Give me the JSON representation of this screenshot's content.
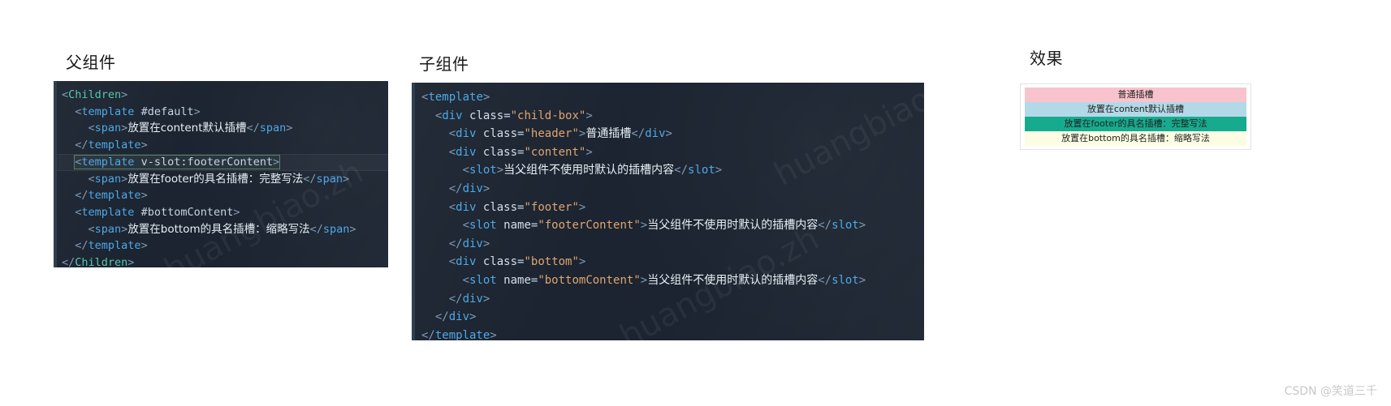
{
  "headings": {
    "parent": "父组件",
    "child": "子组件",
    "effect": "效果"
  },
  "parent_code": {
    "watermark": "huangbiao.zh",
    "lines": [
      {
        "id": "p1",
        "text": "<Children>"
      },
      {
        "id": "p2",
        "text": "  <template #default>"
      },
      {
        "id": "p3",
        "text": "    <span>放置在content默认插槽</span>"
      },
      {
        "id": "p4",
        "text": "  </template>"
      },
      {
        "id": "p5",
        "text": "  <template v-slot:footerContent>"
      },
      {
        "id": "p6",
        "text": "    <span>放置在footer的具名插槽：完整写法</span>"
      },
      {
        "id": "p7",
        "text": "  </template>"
      },
      {
        "id": "p8",
        "text": "  <template #bottomContent>"
      },
      {
        "id": "p9",
        "text": "    <span>放置在bottom的具名插槽：缩略写法</span>"
      },
      {
        "id": "p10",
        "text": "  </template>"
      },
      {
        "id": "p11",
        "text": "</Children>"
      }
    ],
    "tokens": {
      "tag_children_open": "Children",
      "tag_template": "template",
      "attr_default": "#default",
      "attr_vslot_footer": "v-slot:footerContent",
      "attr_bottom": "#bottomContent",
      "tag_span": "span",
      "text_default": "放置在content默认插槽",
      "text_footer": "放置在footer的具名插槽：完整写法",
      "text_bottom": "放置在bottom的具名插槽：缩略写法"
    }
  },
  "child_code": {
    "watermark": "huangbiao.zh",
    "tokens": {
      "tag_template": "template",
      "tag_div": "div",
      "tag_slot": "slot",
      "attr_class": "class",
      "class_child_box": "\"child-box\"",
      "class_header": "\"header\"",
      "class_content": "\"content\"",
      "class_footer": "\"footer\"",
      "class_bottom": "\"bottom\"",
      "attr_name": "name",
      "name_footer": "\"footerContent\"",
      "name_bottom": "\"bottomContent\"",
      "text_header": "普通插槽",
      "text_slot_default": "当父组件不使用时默认的插槽内容"
    }
  },
  "effect": {
    "rows": [
      {
        "label": "普通插槽",
        "color": "#f9c3cd"
      },
      {
        "label": "放置在content默认插槽",
        "color": "#b3d9e8"
      },
      {
        "label": "放置在footer的具名插槽：完整写法",
        "color": "#16ab8f"
      },
      {
        "label": "放置在bottom的具名插槽：缩略写法",
        "color": "#fdfde4"
      }
    ]
  },
  "watermark": {
    "csdn": "CSDN @笑道三千"
  }
}
